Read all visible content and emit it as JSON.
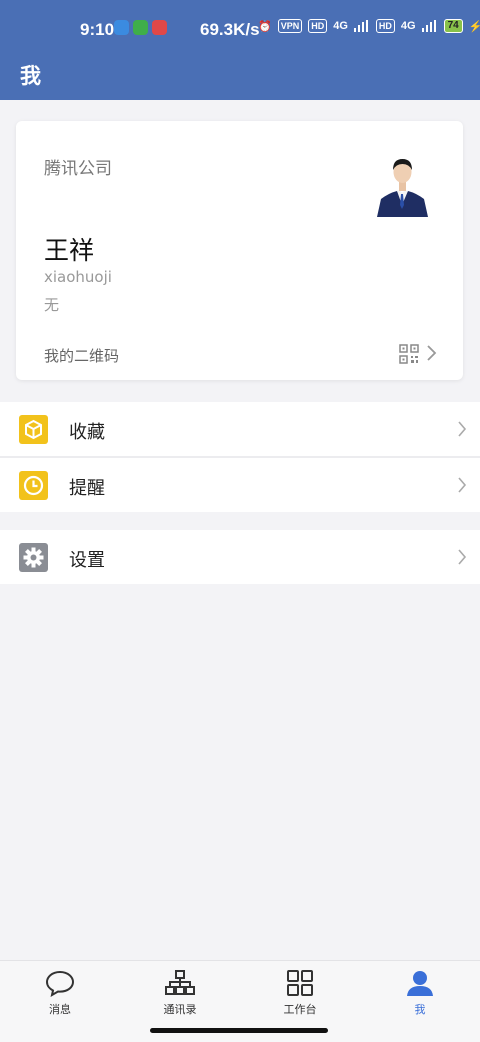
{
  "status_bar": {
    "time": "9:10",
    "network_speed": "69.3K/s",
    "vpn": "VPN",
    "hd1": "HD",
    "signal1": "4G",
    "hd2": "HD",
    "signal2": "4G",
    "battery": "74"
  },
  "header": {
    "title": "我"
  },
  "profile": {
    "company": "腾讯公司",
    "name": "王祥",
    "account": "xiaohuoji",
    "department": "无",
    "qr_label": "我的二维码"
  },
  "menu": {
    "favorites": "收藏",
    "reminders": "提醒",
    "settings": "设置"
  },
  "colors": {
    "header_bg": "#4a6fb5",
    "favorites_icon": "#f2c21b",
    "reminders_icon": "#f2c21b",
    "settings_icon": "#8a8d94",
    "tab_active": "#3a6fd8"
  },
  "tabs": [
    {
      "label": "消息",
      "icon": "chat-bubble-icon",
      "active": false
    },
    {
      "label": "通讯录",
      "icon": "org-chart-icon",
      "active": false
    },
    {
      "label": "工作台",
      "icon": "grid-icon",
      "active": false
    },
    {
      "label": "我",
      "icon": "person-icon",
      "active": true
    }
  ]
}
